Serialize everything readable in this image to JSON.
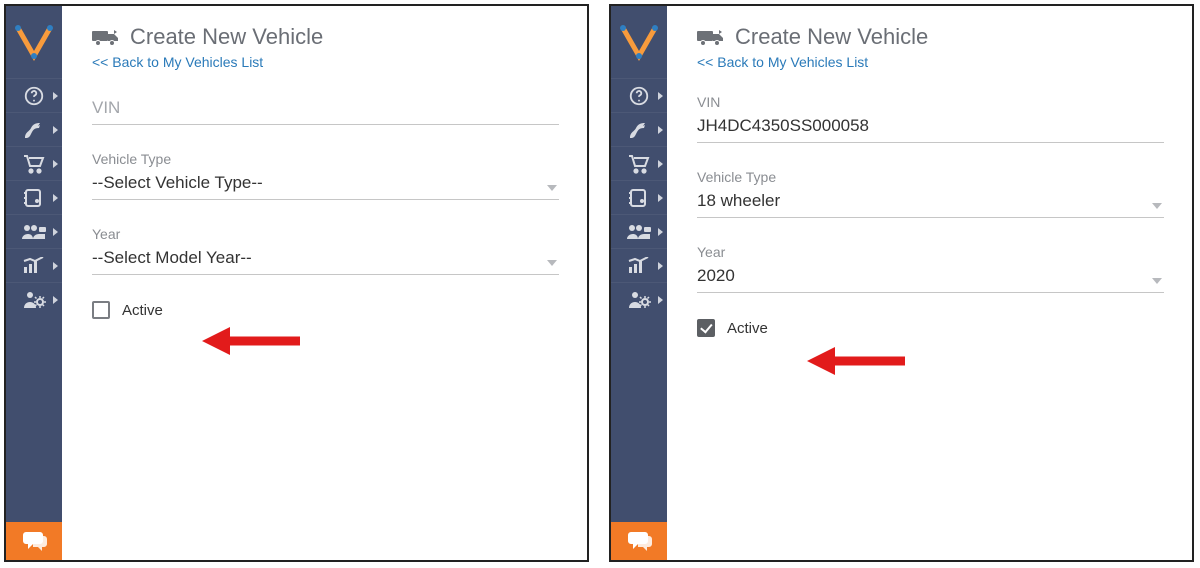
{
  "panels": [
    {
      "title": "Create New Vehicle",
      "back": "<< Back to My Vehicles List",
      "vin": {
        "placeholder": "VIN",
        "value": ""
      },
      "vehicle_type": {
        "label": "Vehicle Type",
        "value": "--Select Vehicle Type--"
      },
      "year": {
        "label": "Year",
        "value": "--Select Model Year--"
      },
      "active": {
        "label": "Active",
        "checked": false
      }
    },
    {
      "title": "Create New Vehicle",
      "back": "<< Back to My Vehicles List",
      "vin": {
        "placeholder": "VIN",
        "value": "JH4DC4350SS000058",
        "label": "VIN"
      },
      "vehicle_type": {
        "label": "Vehicle Type",
        "value": "18 wheeler"
      },
      "year": {
        "label": "Year",
        "value": "2020"
      },
      "active": {
        "label": "Active",
        "checked": true
      }
    }
  ],
  "nav_icons": [
    "help",
    "routes",
    "cart",
    "book",
    "group",
    "chart",
    "admin"
  ]
}
